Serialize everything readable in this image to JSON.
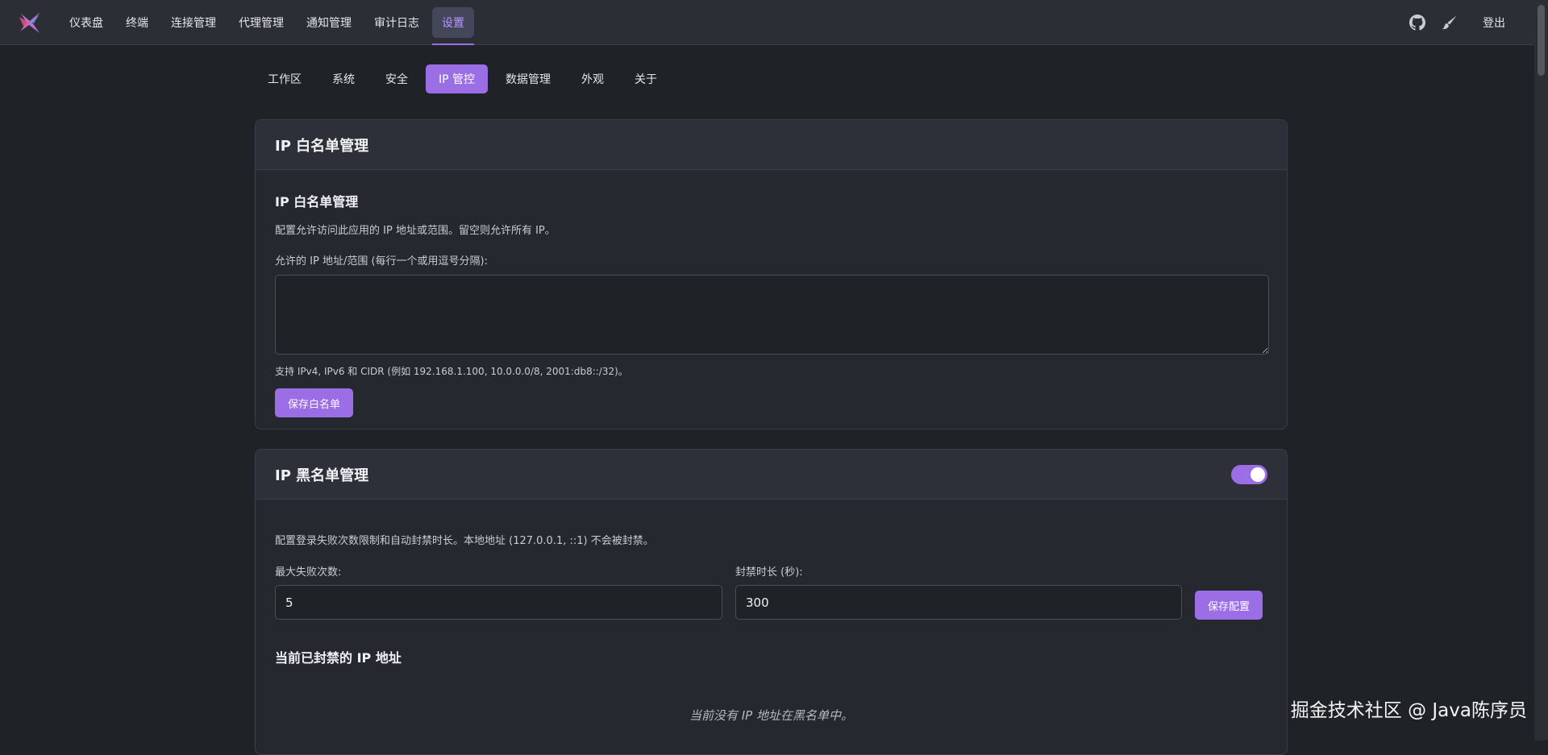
{
  "nav": {
    "items": [
      "仪表盘",
      "终端",
      "连接管理",
      "代理管理",
      "通知管理",
      "审计日志"
    ],
    "active": "设置",
    "logout": "登出"
  },
  "icons": {
    "logo": "app-logo-icon",
    "github": "github-icon",
    "theme": "brush-icon"
  },
  "subtabs": {
    "items": [
      "工作区",
      "系统",
      "安全"
    ],
    "active": "IP 管控",
    "rest": [
      "数据管理",
      "外观",
      "关于"
    ]
  },
  "whitelist": {
    "header": "IP 白名单管理",
    "title": "IP 白名单管理",
    "description": "配置允许访问此应用的 IP 地址或范围。留空则允许所有 IP。",
    "field_label": "允许的 IP 地址/范围 (每行一个或用逗号分隔):",
    "field_value": "",
    "hint": "支持 IPv4, IPv6 和 CIDR (例如 192.168.1.100, 10.0.0.0/8, 2001:db8::/32)。",
    "save_label": "保存白名单"
  },
  "blacklist": {
    "header": "IP 黑名单管理",
    "enabled": true,
    "description": "配置登录失败次数限制和自动封禁时长。本地地址 (127.0.0.1, ::1) 不会被封禁。",
    "max_fail_label": "最大失败次数:",
    "max_fail_value": "5",
    "ban_duration_label": "封禁时长 (秒):",
    "ban_duration_value": "300",
    "save_label": "保存配置",
    "banned_title": "当前已封禁的 IP 地址",
    "empty_text": "当前没有 IP 地址在黑名单中。"
  },
  "watermark": "掘金技术社区 @ Java陈序员",
  "colors": {
    "accent": "#9b6ee6",
    "background": "#1f2227",
    "card": "#25282e",
    "topbar": "#2b2e35"
  }
}
